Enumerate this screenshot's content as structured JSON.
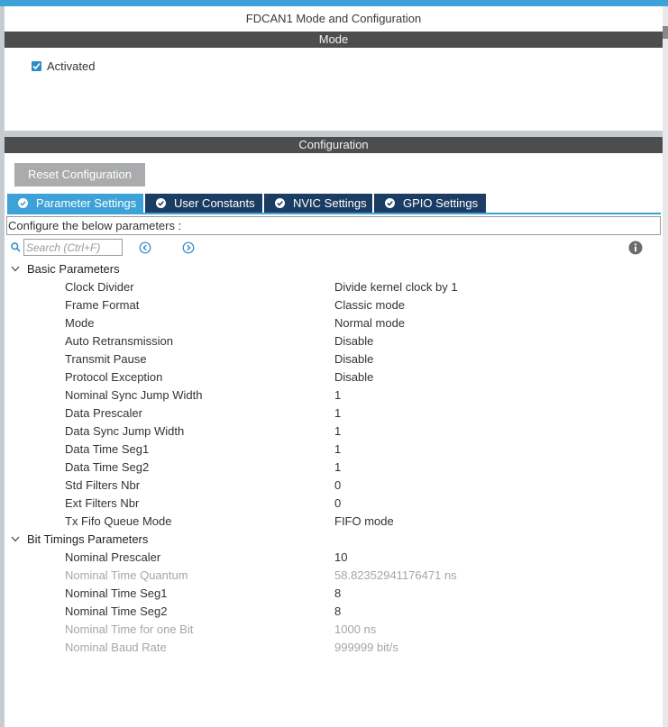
{
  "window": {
    "title": "FDCAN1 Mode and Configuration"
  },
  "mode": {
    "header": "Mode",
    "activated": {
      "label": "Activated",
      "checked": true
    }
  },
  "configuration": {
    "header": "Configuration",
    "reset_label": "Reset Configuration",
    "tabs": [
      {
        "label": "Parameter Settings",
        "active": true,
        "icon": "check-circle-icon"
      },
      {
        "label": "User Constants",
        "active": false,
        "icon": "check-circle-icon"
      },
      {
        "label": "NVIC Settings",
        "active": false,
        "icon": "check-circle-icon"
      },
      {
        "label": "GPIO Settings",
        "active": false,
        "icon": "check-circle-icon"
      }
    ],
    "hint": "Configure the below parameters :",
    "search": {
      "placeholder": "Search (Ctrl+F)",
      "value": ""
    },
    "groups": [
      {
        "label": "Basic Parameters",
        "expanded": true,
        "params": [
          {
            "name": "Clock Divider",
            "value": "Divide kernel clock by 1",
            "enabled": true
          },
          {
            "name": "Frame Format",
            "value": "Classic mode",
            "enabled": true
          },
          {
            "name": "Mode",
            "value": "Normal mode",
            "enabled": true
          },
          {
            "name": "Auto Retransmission",
            "value": "Disable",
            "enabled": true
          },
          {
            "name": "Transmit Pause",
            "value": "Disable",
            "enabled": true
          },
          {
            "name": "Protocol Exception",
            "value": "Disable",
            "enabled": true
          },
          {
            "name": "Nominal Sync Jump Width",
            "value": "1",
            "enabled": true
          },
          {
            "name": "Data Prescaler",
            "value": "1",
            "enabled": true
          },
          {
            "name": "Data Sync Jump Width",
            "value": "1",
            "enabled": true
          },
          {
            "name": "Data Time Seg1",
            "value": "1",
            "enabled": true
          },
          {
            "name": "Data Time Seg2",
            "value": "1",
            "enabled": true
          },
          {
            "name": "Std Filters Nbr",
            "value": "0",
            "enabled": true
          },
          {
            "name": "Ext Filters Nbr",
            "value": "0",
            "enabled": true
          },
          {
            "name": "Tx Fifo Queue Mode",
            "value": "FIFO mode",
            "enabled": true
          }
        ]
      },
      {
        "label": "Bit Timings Parameters",
        "expanded": true,
        "params": [
          {
            "name": "Nominal Prescaler",
            "value": "10",
            "enabled": true
          },
          {
            "name": "Nominal Time Quantum",
            "value": "58.82352941176471 ns",
            "enabled": false
          },
          {
            "name": "Nominal Time Seg1",
            "value": "8",
            "enabled": true
          },
          {
            "name": "Nominal Time Seg2",
            "value": "8",
            "enabled": true
          },
          {
            "name": "Nominal Time for one Bit",
            "value": "1000 ns",
            "enabled": false
          },
          {
            "name": "Nominal Baud Rate",
            "value": "999999 bit/s",
            "enabled": false
          }
        ]
      }
    ]
  },
  "colors": {
    "accent": "#3ca2d7",
    "tab_inactive": "#1b3d63",
    "section_bar": "#4d4d4d",
    "disabled_text": "#a6a6a6"
  }
}
